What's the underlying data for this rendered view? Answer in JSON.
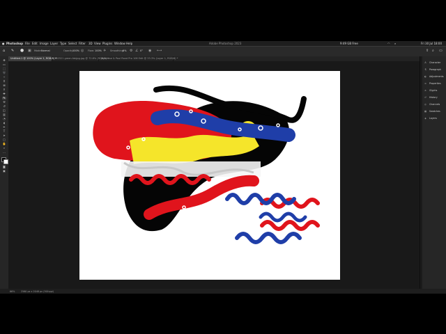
{
  "menubar": {
    "items": [
      "Photoshop",
      "File",
      "Edit",
      "Image",
      "Layer",
      "Type",
      "Select",
      "Filter",
      "3D",
      "View",
      "Plugins",
      "Window",
      "Help"
    ],
    "window_title": "Adobe Photoshop 2023",
    "status_time": "9:49 GB Free",
    "clock": "Fri 30 Jul 18:00"
  },
  "options_bar": {
    "mode_label": "Mode:",
    "mode_value": "Normal",
    "opacity_label": "Opacity:",
    "opacity_value": "100%",
    "flow_label": "Flow:",
    "flow_value": "100%",
    "smoothing_label": "Smoothing:",
    "smoothing_value": "0%",
    "angle_value": "0°"
  },
  "tabs": [
    {
      "label": "Untitled-1 @ 100% (Layer 1, RGB/8) *",
      "active": true
    },
    {
      "label": "160321 green-fabjpg.jpg @ 72.8% (RGB/8) *",
      "active": false
    },
    {
      "label": "Japanese & Paul Rand Pro 106 Edit @ 33.3% (Layer 1, RGB/8) *",
      "active": false
    }
  ],
  "status_bar": {
    "zoom": "66%",
    "doc_info": "2560 px x 2048 px (300 ppi)"
  },
  "panels": [
    {
      "label": "Character",
      "icon": "A"
    },
    {
      "label": "Paragraph",
      "icon": "¶"
    },
    {
      "label": "Adjustments",
      "icon": "◐"
    },
    {
      "label": "Properties",
      "icon": "≡"
    },
    {
      "label": "Glyphs",
      "icon": "a"
    },
    {
      "label": "History",
      "icon": "↺"
    },
    {
      "label": "Channels",
      "icon": "◎"
    },
    {
      "label": "Swatches",
      "icon": "▦"
    },
    {
      "label": "Layers",
      "icon": "◈"
    }
  ],
  "colors": {
    "red": "#e0141c",
    "blue": "#1f3ea8",
    "yellow": "#f5e52a",
    "black": "#050505"
  }
}
